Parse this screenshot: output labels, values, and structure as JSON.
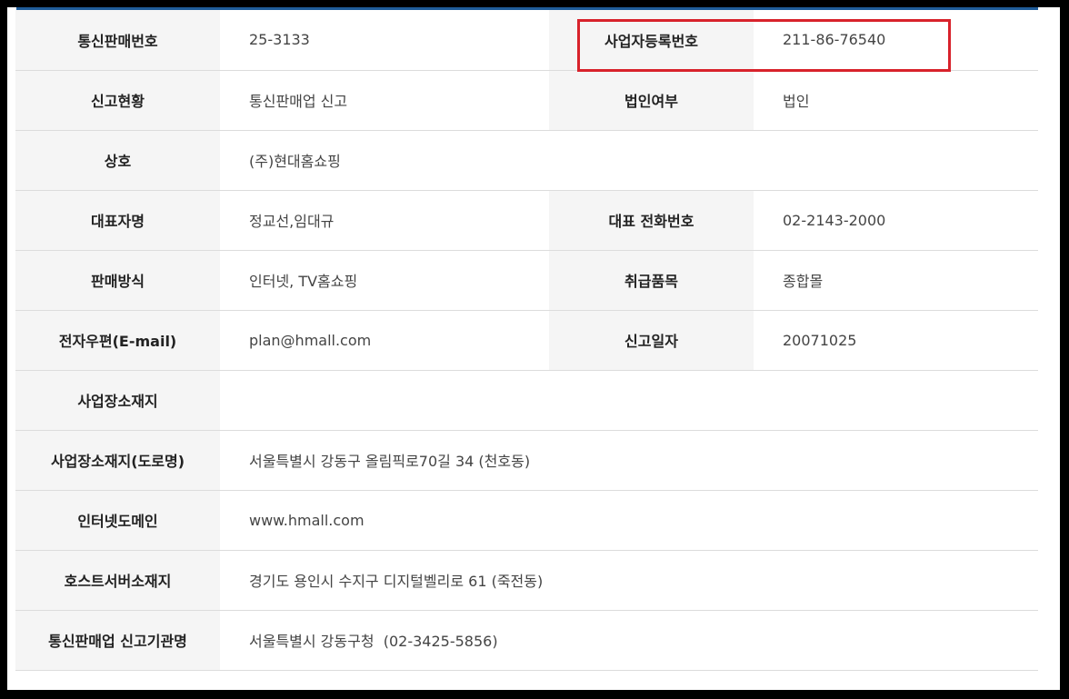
{
  "rows": [
    {
      "label1": "통신판매번호",
      "value1": "25-3133",
      "label2": "사업자등록번호",
      "value2": "211-86-76540"
    },
    {
      "label1": "신고현황",
      "value1": "통신판매업 신고",
      "label2": "법인여부",
      "value2": "법인"
    },
    {
      "label1": "상호",
      "value1": "(주)현대홈쇼핑"
    },
    {
      "label1": "대표자명",
      "value1": "정교선,임대규",
      "label2": "대표 전화번호",
      "value2": "02-2143-2000"
    },
    {
      "label1": "판매방식",
      "value1": "인터넷, TV홈쇼핑",
      "label2": "취급품목",
      "value2": "종합몰"
    },
    {
      "label1": "전자우편(E-mail)",
      "value1": "plan@hmall.com",
      "label2": "신고일자",
      "value2": "20071025"
    },
    {
      "label1": "사업장소재지",
      "value1": ""
    },
    {
      "label1": "사업장소재지(도로명)",
      "value1": "서울특별시 강동구 올림픽로70길 34 (천호동)"
    },
    {
      "label1": "인터넷도메인",
      "value1": "www.hmall.com"
    },
    {
      "label1": "호스트서버소재지",
      "value1": "경기도 용인시 수지구 디지털벨리로 61 (죽전동)"
    },
    {
      "label1": "통신판매업 신고기관명",
      "value1": "서울특별시 강동구청  (02-3425-5856)"
    }
  ],
  "colors": {
    "header_bg": "#f5f5f5",
    "highlight": "#d8222b",
    "top_bar": "#1f5c99"
  }
}
